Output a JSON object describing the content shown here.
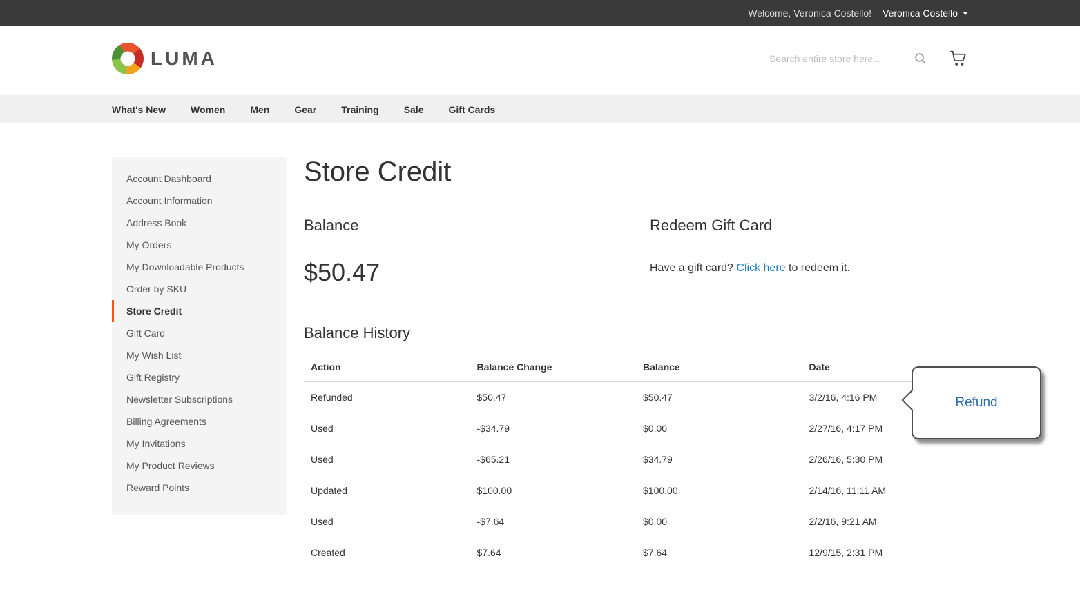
{
  "topbar": {
    "welcome": "Welcome, Veronica Costello!",
    "account_name": "Veronica Costello"
  },
  "header": {
    "logo_text": "LUMA",
    "search": {
      "placeholder": "Search entire store here..."
    }
  },
  "nav": {
    "items": [
      "What's New",
      "Women",
      "Men",
      "Gear",
      "Training",
      "Sale",
      "Gift Cards"
    ]
  },
  "sidebar": {
    "items": [
      {
        "label": "Account Dashboard",
        "active": false
      },
      {
        "label": "Account Information",
        "active": false
      },
      {
        "label": "Address Book",
        "active": false
      },
      {
        "label": "My Orders",
        "active": false
      },
      {
        "label": "My Downloadable Products",
        "active": false
      },
      {
        "label": "Order by SKU",
        "active": false
      },
      {
        "label": "Store Credit",
        "active": true
      },
      {
        "label": "Gift Card",
        "active": false
      },
      {
        "label": "My Wish List",
        "active": false
      },
      {
        "label": "Gift Registry",
        "active": false
      },
      {
        "label": "Newsletter Subscriptions",
        "active": false
      },
      {
        "label": "Billing Agreements",
        "active": false
      },
      {
        "label": "My Invitations",
        "active": false
      },
      {
        "label": "My Product Reviews",
        "active": false
      },
      {
        "label": "Reward Points",
        "active": false
      }
    ]
  },
  "main": {
    "title": "Store Credit",
    "balance": {
      "heading": "Balance",
      "amount": "$50.47"
    },
    "redeem": {
      "heading": "Redeem Gift Card",
      "text_before": "Have a gift card?",
      "link_text": "Click here",
      "text_after": "to redeem it."
    },
    "history": {
      "heading": "Balance History",
      "columns": [
        "Action",
        "Balance Change",
        "Balance",
        "Date"
      ],
      "rows": [
        [
          "Refunded",
          "$50.47",
          "$50.47",
          "3/2/16, 4:16 PM"
        ],
        [
          "Used",
          "-$34.79",
          "$0.00",
          "2/27/16, 4:17 PM"
        ],
        [
          "Used",
          "-$65.21",
          "$34.79",
          "2/26/16, 5:30 PM"
        ],
        [
          "Updated",
          "$100.00",
          "$100.00",
          "2/14/16, 11:11 AM"
        ],
        [
          "Used",
          "-$7.64",
          "$0.00",
          "2/2/16, 9:21 AM"
        ],
        [
          "Created",
          "$7.64",
          "$7.64",
          "12/9/15, 2:31 PM"
        ]
      ]
    }
  },
  "annotation": {
    "label": "Refund"
  },
  "colors": {
    "accent_orange": "#ff5501",
    "link_blue": "#1979c3",
    "topbar_bg": "#3a3a3a",
    "annotation_text": "#2a6ab0"
  }
}
